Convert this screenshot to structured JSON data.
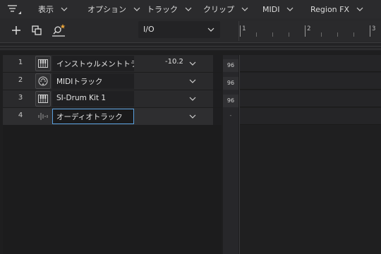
{
  "menu": {
    "items": [
      "表示",
      "オプション",
      "トラック",
      "クリップ",
      "MIDI",
      "Region FX"
    ]
  },
  "toolbar": {
    "io_label": "I/O"
  },
  "ruler": {
    "marks": [
      "1",
      "2",
      "3"
    ]
  },
  "tracks": [
    {
      "number": "1",
      "name": "インストゥルメントトラック",
      "icon": "piano-keys-icon",
      "volume": "-10.2",
      "mix_value": "96"
    },
    {
      "number": "2",
      "name": "MIDIトラック",
      "icon": "midi-connector-icon",
      "volume": "",
      "mix_value": "96"
    },
    {
      "number": "3",
      "name": "SI-Drum Kit 1",
      "icon": "piano-keys-icon",
      "volume": "",
      "mix_value": "96"
    },
    {
      "number": "4",
      "name": "オーディオトラック",
      "icon": "audio-waveform-icon",
      "volume": "",
      "mix_value": "-"
    }
  ],
  "colors": {
    "accent": "#5aa0de",
    "favorite_star": "#e8a33a"
  }
}
